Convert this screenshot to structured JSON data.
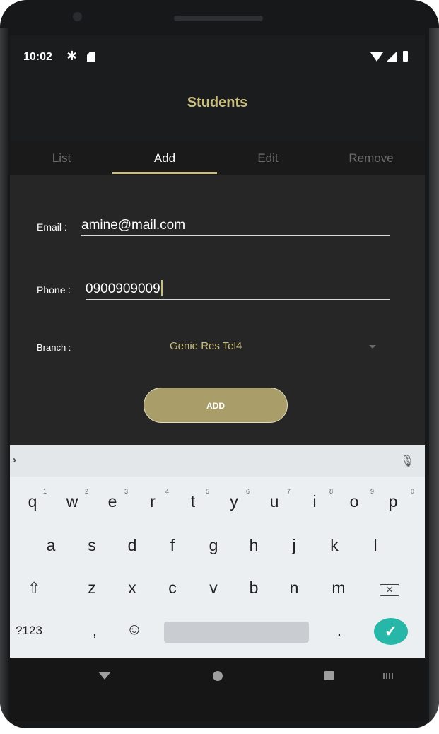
{
  "status_bar": {
    "time": "10:02"
  },
  "app": {
    "title": "Students"
  },
  "tabs": [
    {
      "label": "List",
      "active": false
    },
    {
      "label": "Add",
      "active": true
    },
    {
      "label": "Edit",
      "active": false
    },
    {
      "label": "Remove",
      "active": false
    }
  ],
  "form": {
    "email_label": "Email :",
    "email_value": "amine@mail.com",
    "phone_label": "Phone :",
    "phone_value": "0900909009",
    "branch_label": "Branch :",
    "branch_value": "Genie Res Tel4",
    "add_button": "ADD"
  },
  "keyboard": {
    "row1": [
      "q",
      "w",
      "e",
      "r",
      "t",
      "y",
      "u",
      "i",
      "o",
      "p"
    ],
    "row1_hints": [
      "1",
      "2",
      "3",
      "4",
      "5",
      "6",
      "7",
      "8",
      "9",
      "0"
    ],
    "row2": [
      "a",
      "s",
      "d",
      "f",
      "g",
      "h",
      "j",
      "k",
      "l"
    ],
    "row3": [
      "z",
      "x",
      "c",
      "v",
      "b",
      "n",
      "m"
    ],
    "symbols_key": "?123",
    "comma_key": ",",
    "period_key": ".",
    "emoji_key": "☺",
    "shift_key": "⇧",
    "backspace_key": "✕",
    "enter_key": "✓",
    "suggest_chevron": "›",
    "mic_icon": "🎙"
  },
  "colors": {
    "accent": "#c9bd80",
    "button": "#a99d6a",
    "background": "#262626",
    "enter": "#27b7a8"
  }
}
